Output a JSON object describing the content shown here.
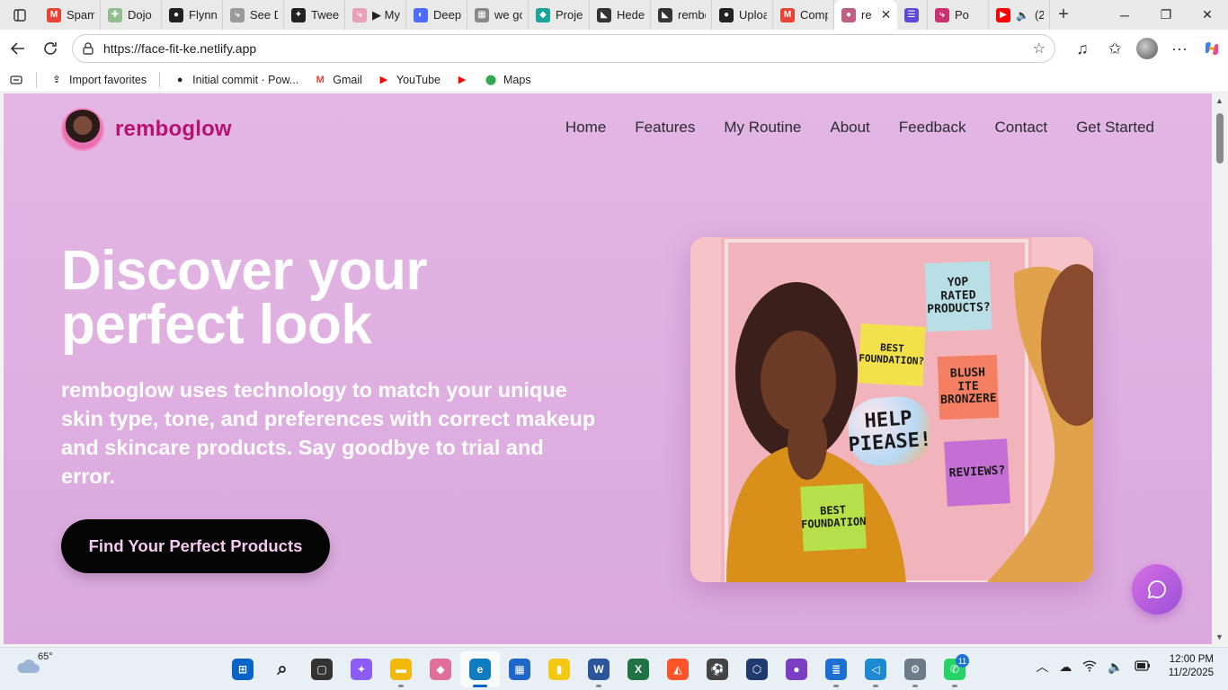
{
  "browser": {
    "tabs": [
      {
        "label": "Spam",
        "fav": "gmail",
        "color": "#ea4335"
      },
      {
        "label": "Dojo G",
        "fav": "dojo",
        "color": "#8fbf8f"
      },
      {
        "label": "FlynnS",
        "fav": "github",
        "color": "#222222"
      },
      {
        "label": "See De",
        "fav": "link",
        "color": "#9a9a9a"
      },
      {
        "label": "Tweet",
        "fav": "openai",
        "color": "#222222"
      },
      {
        "label": "▶ My",
        "fav": "link",
        "color": "#e9a0b8"
      },
      {
        "label": "DeepS",
        "fav": "deepseek",
        "color": "#4d6bfe"
      },
      {
        "label": "we go",
        "fav": "image",
        "color": "#8a8a8a"
      },
      {
        "label": "Projec",
        "fav": "diamond",
        "color": "#1aa39a"
      },
      {
        "label": "Heder",
        "fav": "cat",
        "color": "#333333"
      },
      {
        "label": "rembo",
        "fav": "cat",
        "color": "#333333"
      },
      {
        "label": "Uploa",
        "fav": "github",
        "color": "#222222"
      },
      {
        "label": "Comp",
        "fav": "gmail",
        "color": "#ea4335"
      },
      {
        "label": "re",
        "fav": "remboglow",
        "color": "#c06080",
        "active": true
      },
      {
        "label": "",
        "fav": "list",
        "color": "#5b4bd6"
      },
      {
        "label": "Po",
        "fav": "link",
        "color": "#c8326e"
      },
      {
        "label": "(2",
        "fav": "youtube",
        "color": "#ff0000",
        "audio": true
      }
    ],
    "url": "https://face-fit-ke.netlify.app",
    "bookmarks": [
      {
        "label": "Import favorites",
        "icon": "import-icon"
      },
      {
        "label": "Initial commit · Pow...",
        "icon": "github-icon"
      },
      {
        "label": "Gmail",
        "icon": "gmail-icon"
      },
      {
        "label": "YouTube",
        "icon": "youtube-icon"
      },
      {
        "label": "",
        "icon": "youtube-icon"
      },
      {
        "label": "Maps",
        "icon": "maps-icon"
      }
    ]
  },
  "site": {
    "brand": "remboglow",
    "nav": [
      "Home",
      "Features",
      "My Routine",
      "About",
      "Feedback",
      "Contact",
      "Get Started"
    ],
    "hero": {
      "title": "Discover your perfect look",
      "subtitle": "remboglow uses technology to match your unique skin type, tone, and preferences with correct makeup and skincare products. Say goodbye to trial and error.",
      "cta": "Find Your Perfect Products"
    },
    "image_notes": [
      {
        "text": "YOP\nRATED\nPRODUCTS?",
        "color": "#b9dfe6"
      },
      {
        "text": "BEST\nFOUNDATION?",
        "color": "#f2e14a"
      },
      {
        "text": "BLUSH\nITE\nBRONZERE",
        "color": "#f47f63"
      },
      {
        "text": "HELP\nPIEASE!",
        "color": "#f4c6d7"
      },
      {
        "text": "REVIEWS?",
        "color": "#c56ed4"
      },
      {
        "text": "BEST\nFOUNDATION",
        "color": "#b7e04a"
      }
    ]
  },
  "taskbar": {
    "weather": "65°",
    "time": "12:00 PM",
    "date": "11/2/2025",
    "whatsapp_badge": "11"
  },
  "colors": {
    "page_bg": "#dfb0e0",
    "brand": "#b5136f",
    "cta_bg": "#050505",
    "cta_text": "#f3c9ef",
    "chat_button": "#c063df"
  }
}
